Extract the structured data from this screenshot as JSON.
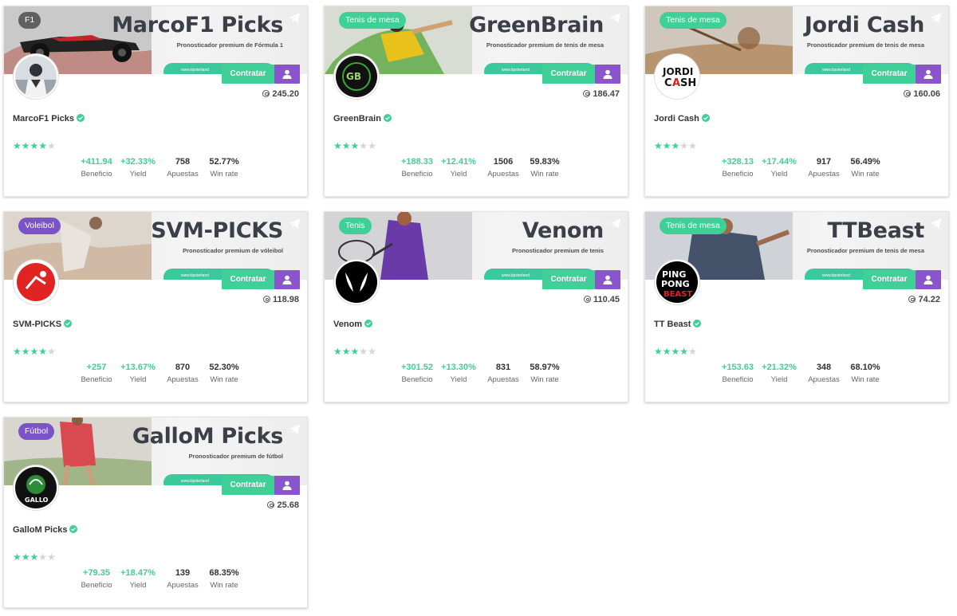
{
  "cards": [
    {
      "category": "F1",
      "tag_style": "dark",
      "banner_title": "MarcoF1 Picks",
      "banner_subtitle": "Pronosticador premium de Fórmula 1",
      "banner_link": "www.tipsterland",
      "avatar": "marco-avatar",
      "avatar_color": "#7a8a99",
      "contratar": "Contratar",
      "coins": "245.20",
      "name": "MarcoF1 Picks",
      "rating": 4,
      "stats": {
        "beneficio": "+411.94",
        "yield": "+32.33%",
        "apuestas": "758",
        "winrate": "52.77%"
      },
      "labels": {
        "beneficio": "Beneficio",
        "yield": "Yield",
        "apuestas": "Apuestas",
        "winrate": "Win rate"
      }
    },
    {
      "category": "Tenis de mesa",
      "tag_style": "green",
      "banner_title": "GreenBrain",
      "banner_subtitle": "Pronosticador premium de tenis de mesa",
      "banner_link": "www.tipsterland",
      "avatar": "greenbrain-logo",
      "avatar_color": "#111111",
      "contratar": "Contratar",
      "coins": "186.47",
      "name": "GreenBrain",
      "rating": 3,
      "stats": {
        "beneficio": "+188.33",
        "yield": "+12.41%",
        "apuestas": "1506",
        "winrate": "59.83%"
      },
      "labels": {
        "beneficio": "Beneficio",
        "yield": "Yield",
        "apuestas": "Apuestas",
        "winrate": "Win rate"
      }
    },
    {
      "category": "Tenis de mesa",
      "tag_style": "green",
      "banner_title": "Jordi Cash",
      "banner_subtitle": "Pronosticador premium de tenis de mesa",
      "banner_link": "www.tipsterland",
      "avatar": "jordi-cash-logo",
      "avatar_color": "#ffffff",
      "avatar_text": "JORDI CASH",
      "contratar": "Contratar",
      "coins": "160.06",
      "name": "Jordi Cash",
      "rating": 3,
      "stats": {
        "beneficio": "+328.13",
        "yield": "+17.44%",
        "apuestas": "917",
        "winrate": "56.49%"
      },
      "labels": {
        "beneficio": "Beneficio",
        "yield": "Yield",
        "apuestas": "Apuestas",
        "winrate": "Win rate"
      }
    },
    {
      "category": "Voleibol",
      "tag_style": "purple",
      "banner_title": "SVM-PICKS",
      "banner_subtitle": "Pronosticador premium de vóleibol",
      "banner_link": "www.tipsterland",
      "avatar": "svm-logo",
      "avatar_color": "#e02424",
      "contratar": "Contratar",
      "coins": "118.98",
      "name": "SVM-PICKS",
      "rating": 4,
      "stats": {
        "beneficio": "+257",
        "yield": "+13.67%",
        "apuestas": "870",
        "winrate": "52.30%"
      },
      "labels": {
        "beneficio": "Beneficio",
        "yield": "Yield",
        "apuestas": "Apuestas",
        "winrate": "Win rate"
      }
    },
    {
      "category": "Tenis",
      "tag_style": "green",
      "banner_title": "Venom",
      "banner_subtitle": "Pronosticador premium de tenis",
      "banner_link": "www.tipsterland",
      "avatar": "venom-logo",
      "avatar_color": "#000000",
      "contratar": "Contratar",
      "coins": "110.45",
      "name": "Venom",
      "rating": 3,
      "stats": {
        "beneficio": "+301.52",
        "yield": "+13.30%",
        "apuestas": "831",
        "winrate": "58.97%"
      },
      "labels": {
        "beneficio": "Beneficio",
        "yield": "Yield",
        "apuestas": "Apuestas",
        "winrate": "Win rate"
      }
    },
    {
      "category": "Tenis de mesa",
      "tag_style": "green",
      "banner_title": "TTBeast",
      "banner_subtitle": "Pronosticador premium de tenis de mesa",
      "banner_link": "www.tipsterland",
      "avatar": "ping-pong-beast-logo",
      "avatar_color": "#000000",
      "avatar_text": "PING PONG BEAST",
      "contratar": "Contratar",
      "coins": "74.22",
      "name": "TT Beast",
      "rating": 4,
      "stats": {
        "beneficio": "+153.63",
        "yield": "+21.32%",
        "apuestas": "348",
        "winrate": "68.10%"
      },
      "labels": {
        "beneficio": "Beneficio",
        "yield": "Yield",
        "apuestas": "Apuestas",
        "winrate": "Win rate"
      }
    },
    {
      "category": "Fútbol",
      "tag_style": "purple",
      "banner_title": "GalloM Picks",
      "banner_subtitle": "Pronosticador premium de fútbol",
      "banner_link": "www.tipsterland",
      "avatar": "gallo-logo",
      "avatar_color": "#111111",
      "avatar_text": "GALLO",
      "contratar": "Contratar",
      "coins": "25.68",
      "name": "GalloM Picks",
      "rating": 3,
      "stats": {
        "beneficio": "+79.35",
        "yield": "+18.47%",
        "apuestas": "139",
        "winrate": "68.35%"
      },
      "labels": {
        "beneficio": "Beneficio",
        "yield": "Yield",
        "apuestas": "Apuestas",
        "winrate": "Win rate"
      }
    }
  ],
  "colors": {
    "accent_green": "#3fcf97",
    "accent_purple": "#8a55cc",
    "tag_purple": "#7a53c9"
  }
}
